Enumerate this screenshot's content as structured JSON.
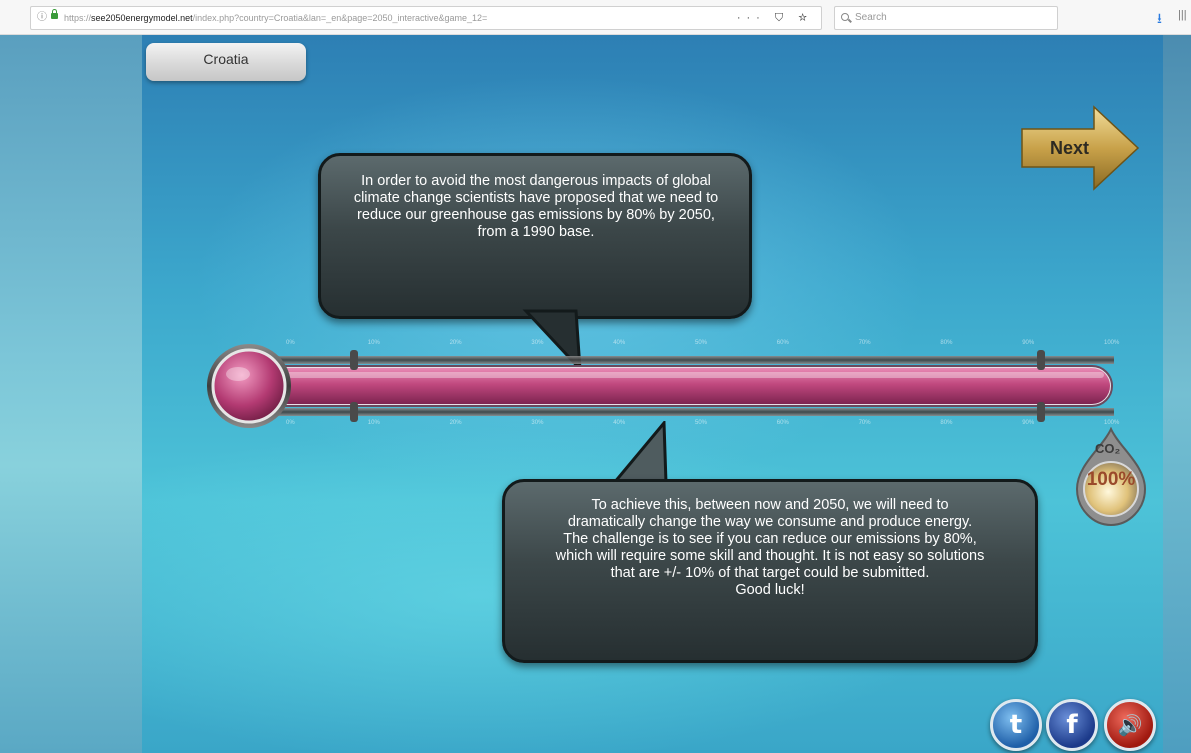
{
  "browser": {
    "url_prefix": "https://",
    "url_domain": "see2050energymodel.net",
    "url_path": "/index.php?country=Croatia&lan=_en&page=2050_interactive&game_12=",
    "page_actions": "··· ⛉ ☆",
    "search_placeholder": "Search"
  },
  "game": {
    "country": "Croatia",
    "next_label": "Next",
    "bubble_top": "In order to avoid the most dangerous impacts of global climate change scientists have proposed that we need to reduce our greenhouse gas emissions by 80% by 2050, from a 1990 base.",
    "bubble_bottom_lines": [
      "To achieve this, between now and 2050, we will need to",
      "dramatically change the way we consume and produce energy.",
      "The challenge is to see if you can reduce our emissions by 80%,",
      "which will require some skill and thought. It is not easy so solutions",
      "that are +/- 10% of that target could be submitted.",
      "Good luck!"
    ],
    "thermometer": {
      "level_percent": 100,
      "scale_ticks": [
        "0%",
        "10%",
        "20%",
        "30%",
        "40%",
        "50%",
        "60%",
        "70%",
        "80%",
        "90%",
        "100%"
      ]
    },
    "co2_gauge": {
      "label": "CO₂",
      "value": "100%"
    }
  },
  "social": {
    "twitter_glyph": "t",
    "facebook_glyph": "f",
    "sound_glyph": "🔊"
  },
  "colors": {
    "bubble_bg": "#3c4749",
    "thermometer_fill": "#c0487e",
    "next_gold": "#c9a24a"
  }
}
